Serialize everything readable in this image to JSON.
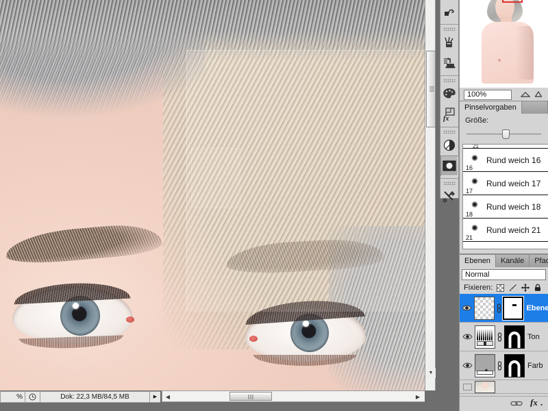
{
  "application": "Adobe Photoshop",
  "canvas": {
    "subject": "retouching-photo-woman-eyes-grey-blonde-hair",
    "overlay_selection": "layer-preview-rectangle"
  },
  "tools": {
    "groups": [
      {
        "items": [
          {
            "name": "history-brush-tool",
            "icon": "history-brush-icon"
          }
        ]
      },
      {
        "items": [
          {
            "name": "art-history-brush-tool",
            "icon": "art-brush-icon"
          },
          {
            "name": "clone-stamp-tool",
            "icon": "stamp-icon"
          }
        ]
      },
      {
        "items": [
          {
            "name": "palette-tool",
            "icon": "palette-icon"
          },
          {
            "name": "effects-tool",
            "icon": "fx-icon"
          }
        ]
      },
      {
        "items": [
          {
            "name": "adjustment-tool",
            "icon": "half-circle-icon"
          },
          {
            "name": "quick-mask-tool",
            "icon": "quick-mask-icon",
            "selected": true
          }
        ]
      },
      {
        "items": [
          {
            "name": "tool-presets",
            "icon": "scissors-screwdriver-icon"
          }
        ]
      }
    ]
  },
  "statusbar": {
    "zoom": "%",
    "doc_icon": "clock-icon",
    "doc_info": "Dok: 22,3 MB/84,5 MB",
    "more_arrow": "▶"
  },
  "scrollbars": {
    "vertical": {
      "name": "canvas-vertical-scrollbar"
    },
    "horizontal": {
      "name": "canvas-horizontal-scrollbar"
    },
    "left_arrow": "◀",
    "right_arrow": "▶",
    "down_arrow": "▼"
  },
  "navigator": {
    "zoom_value": "100%",
    "preview_label": "navigator-thumbnail"
  },
  "brush_panel": {
    "tabs": [
      {
        "label": "Pinselvorgaben",
        "active": true
      },
      {
        "label": "",
        "active": false
      }
    ],
    "size_label": "Größe:",
    "partial_top_item": "21",
    "presets": [
      {
        "label": "Rund weich 16",
        "size": "16"
      },
      {
        "label": "Rund weich 17",
        "size": "17"
      },
      {
        "label": "Rund weich 18",
        "size": "18"
      },
      {
        "label": "Rund weich 21",
        "size": "21"
      }
    ]
  },
  "layers_panel": {
    "tabs": [
      {
        "label": "Ebenen",
        "active": true
      },
      {
        "label": "Kanäle",
        "active": false
      },
      {
        "label": "Pfade",
        "active": false
      }
    ],
    "blend_mode": "Normal",
    "lock_label": "Fixieren:",
    "lock_icons": [
      {
        "name": "lock-transparency-icon"
      },
      {
        "name": "lock-pixels-brush-icon"
      },
      {
        "name": "lock-position-move-icon"
      },
      {
        "name": "lock-all-padlock-icon"
      }
    ],
    "layers": [
      {
        "name": "Ebene",
        "type": "pixel-layer-with-mask",
        "selected": true,
        "visible": true
      },
      {
        "name": "Ton",
        "type": "curves-adjustment-layer",
        "selected": false,
        "visible": true
      },
      {
        "name": "Farb",
        "type": "gradient-fill-layer",
        "selected": false,
        "visible": true
      },
      {
        "name": "",
        "type": "background-layer",
        "selected": false,
        "visible": false
      }
    ],
    "footer_icons": [
      {
        "name": "link-layers-icon"
      },
      {
        "name": "layer-style-fx-icon"
      }
    ]
  },
  "colors": {
    "panel_bg": "#d4d4d4",
    "selection_blue": "#1d7ee8",
    "workspace_gray": "#6e6e6e",
    "border": "#8d8d8d"
  }
}
